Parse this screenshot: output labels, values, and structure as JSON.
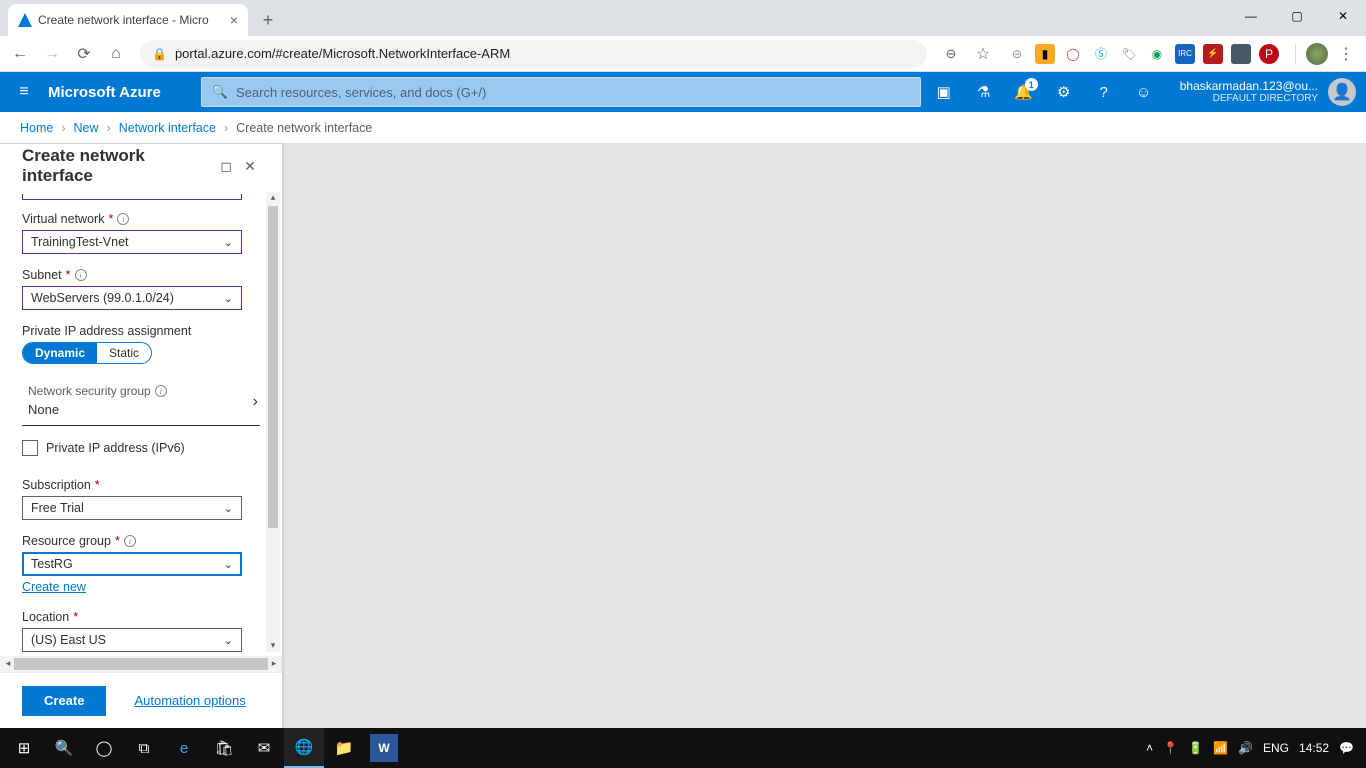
{
  "browser": {
    "tab_title": "Create network interface - Micro",
    "url": "portal.azure.com/#create/Microsoft.NetworkInterface-ARM"
  },
  "azure": {
    "brand": "Microsoft Azure",
    "search_placeholder": "Search resources, services, and docs (G+/)",
    "notification_count": "1",
    "user_email": "bhaskarmadan.123@ou...",
    "user_directory": "DEFAULT DIRECTORY"
  },
  "breadcrumbs": {
    "items": [
      "Home",
      "New",
      "Network interface",
      "Create network interface"
    ]
  },
  "blade": {
    "title": "Create network interface",
    "vnet_label": "Virtual network",
    "vnet_value": "TrainingTest-Vnet",
    "subnet_label": "Subnet",
    "subnet_value": "WebServers (99.0.1.0/24)",
    "ip_assign_label": "Private IP address assignment",
    "ip_assign_dynamic": "Dynamic",
    "ip_assign_static": "Static",
    "nsg_label": "Network security group",
    "nsg_value": "None",
    "ipv6_label": "Private IP address (IPv6)",
    "sub_label": "Subscription",
    "sub_value": "Free Trial",
    "rg_label": "Resource group",
    "rg_value": "TestRG",
    "create_new": "Create new",
    "loc_label": "Location",
    "loc_value": "(US) East US",
    "create_btn": "Create",
    "automation": "Automation options"
  },
  "taskbar": {
    "lang": "ENG",
    "time": "14:52"
  }
}
